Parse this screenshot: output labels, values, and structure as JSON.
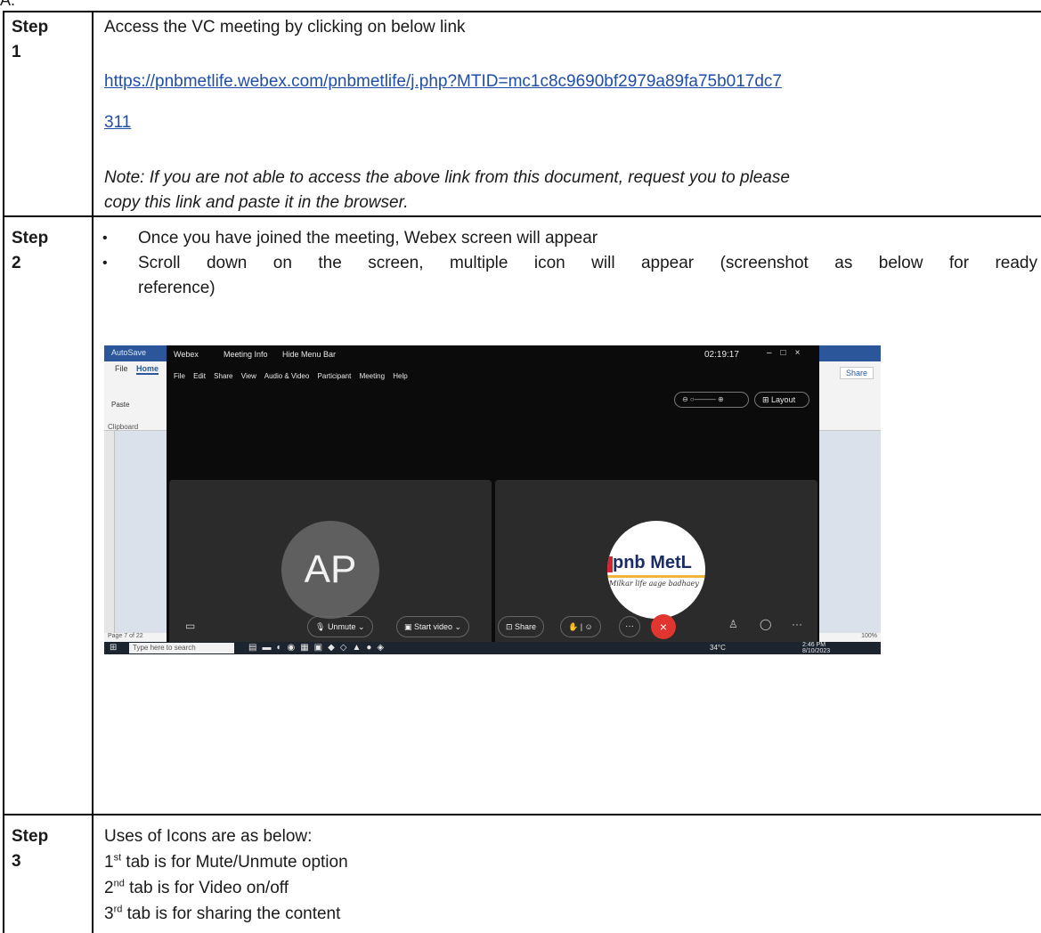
{
  "stray_text": "A.",
  "step1": {
    "label_word": "Step",
    "label_num": "1",
    "intro": "Access the VC meeting by clicking on below link",
    "link_line1": "https://pnbmetlife.webex.com/pnbmetlife/j.php?MTID=mc1c8c9690bf2979a89fa75b017dc7",
    "link_line2": "311",
    "note_line1": "Note: If you are not able to access the above link from this document, request you to please",
    "note_line2": "copy this link and paste it in the browser."
  },
  "step2": {
    "label_word": "Step",
    "label_num": "2",
    "bullet_char": "•",
    "bullet1": "Once you have joined the meeting, Webex screen will appear",
    "bullet2_line1": "Scroll down on the screen, multiple icon will appear (screenshot as below for ready",
    "bullet2_line2": "reference)"
  },
  "screenshot": {
    "word": {
      "autosave": "AutoSave",
      "tab_file": "File",
      "tab_home": "Home",
      "paste": "Paste",
      "clipboard": "Clipboard",
      "share": "Share",
      "page_status": "Page 7 of 22",
      "zoom": "100%"
    },
    "webex": {
      "brand": "Webex",
      "meeting_info": "Meeting Info",
      "hide_menu": "Hide Menu Bar",
      "clock": "02:19:17",
      "menu": [
        "File",
        "Edit",
        "Share",
        "View",
        "Audio & Video",
        "Participant",
        "Meeting",
        "Help"
      ],
      "layout": "Layout",
      "avatar_initials": "AP",
      "logo_name": "pnb MetL",
      "logo_tagline": "Milkar life aage badhaey",
      "unmute": "Unmute",
      "start_video": "Start video",
      "share": "Share"
    },
    "taskbar": {
      "search_placeholder": "Type here to search",
      "temperature": "34°C",
      "time": "2:46 PM",
      "date": "8/10/2023"
    }
  },
  "step3": {
    "label_word": "Step",
    "label_num": "3",
    "intro": "Uses of Icons are as below:",
    "items": [
      {
        "num": "1",
        "suffix": "st",
        "text": " tab is for Mute/Unmute option"
      },
      {
        "num": "2",
        "suffix": "nd",
        "text": " tab is for Video on/off"
      },
      {
        "num": "3",
        "suffix": "rd",
        "text": " tab is for sharing the content"
      }
    ]
  }
}
